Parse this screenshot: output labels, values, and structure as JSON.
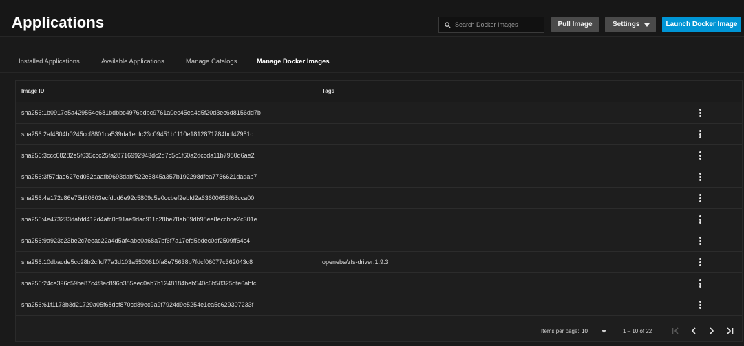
{
  "header": {
    "title": "Applications",
    "search_placeholder": "Search Docker Images",
    "pull_label": "Pull Image",
    "settings_label": "Settings",
    "launch_label": "Launch Docker Image",
    "accent_color": "#0095d5"
  },
  "tabs": [
    {
      "label": "Installed Applications",
      "active": false
    },
    {
      "label": "Available Applications",
      "active": false
    },
    {
      "label": "Manage Catalogs",
      "active": false
    },
    {
      "label": "Manage Docker Images",
      "active": true
    }
  ],
  "table": {
    "columns": [
      "Image ID",
      "Tags"
    ],
    "rows": [
      {
        "id": "sha256:1b0917e5a429554e681bdbbc4976bdbc9761a0ec45ea4d5f20d3ec6d8156dd7b",
        "tags": ""
      },
      {
        "id": "sha256:2af4804b0245ccf8801ca539da1ecfc23c09451b1110e1812871784bcf47951c",
        "tags": ""
      },
      {
        "id": "sha256:3ccc68282e5f635ccc25fa28716992943dc2d7c5c1f60a2dccda11b7980d6ae2",
        "tags": ""
      },
      {
        "id": "sha256:3f57dae627ed052aaafb9693dabf522e5845a357b192298dfea7736621dadab7",
        "tags": ""
      },
      {
        "id": "sha256:4e172c86e75d80803ecfddd6e92c5809c5e0ccbef2ebfd2a63600658f66cca00",
        "tags": ""
      },
      {
        "id": "sha256:4e473233dafdd412d4afc0c91ae9dac911c28be78ab09db98ee8eccbce2c301e",
        "tags": ""
      },
      {
        "id": "sha256:9a923c23be2c7eeac22a4d5af4abe0a68a7bf6f7a17efd5bdec0df2509ff64c4",
        "tags": ""
      },
      {
        "id": "sha256:10dbacde5cc28b2cffd77a3d103a5500610fa8e75638b7fdcf06077c362043c8",
        "tags": "openebs/zfs-driver:1.9.3"
      },
      {
        "id": "sha256:24ce396c59be87c4f3ec896b385eec0ab7b1248184beb540c6b58325dfe6abfc",
        "tags": ""
      },
      {
        "id": "sha256:61f1173b3d21729a05f68dcf870cd89ec9a9f7924d9e5254e1ea5c629307233f",
        "tags": ""
      }
    ]
  },
  "paginator": {
    "items_per_page_label": "Items per page:",
    "items_per_page": "10",
    "range_label": "1 – 10 of 22"
  }
}
